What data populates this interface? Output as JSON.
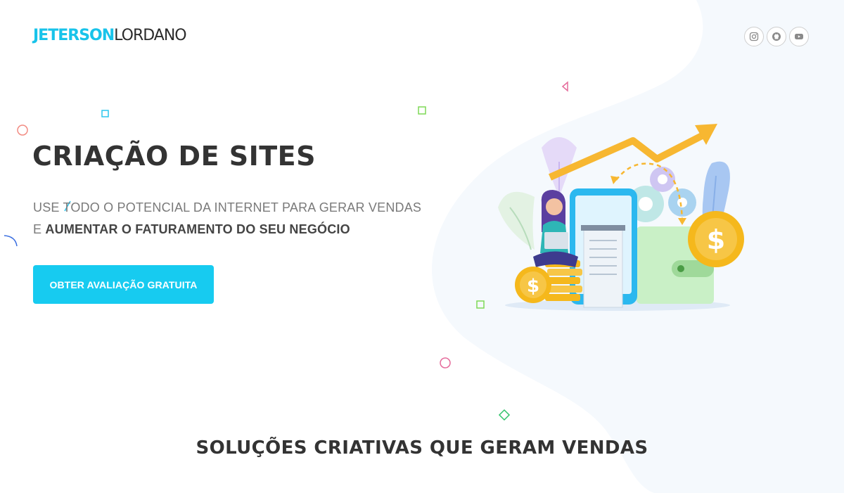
{
  "logo": {
    "first": "JETERSON",
    "last": "LORDANO"
  },
  "social": [
    {
      "name": "Instagram",
      "icon": "instagram-icon"
    },
    {
      "name": "GitHub",
      "icon": "github-icon"
    },
    {
      "name": "YouTube",
      "icon": "youtube-icon"
    }
  ],
  "hero": {
    "title": "CRIAÇÃO DE SITES",
    "subtitle_plain": "USE TODO O POTENCIAL DA INTERNET PARA GERAR VENDAS E ",
    "subtitle_bold": "AUMENTAR O FATURAMENTO DO SEU NEGÓCIO",
    "cta_label": "OBTER AVALIAÇÃO GRATUITA",
    "illustration": "sales-growth-illustration",
    "illustration_text": "$"
  },
  "section": {
    "title": "SOLUÇÕES CRIATIVAS QUE GERAM VENDAS"
  },
  "colors": {
    "accent": "#17cbf0",
    "heading": "#333333",
    "text": "#7a7a7a",
    "coin": "#f5b81c",
    "arrow": "#f7b731"
  }
}
